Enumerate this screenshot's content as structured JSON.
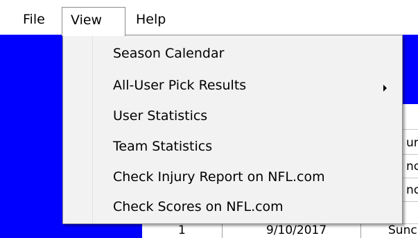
{
  "menubar": {
    "items": [
      {
        "label": "File"
      },
      {
        "label": "View"
      },
      {
        "label": "Help"
      }
    ]
  },
  "view_menu": {
    "items": [
      {
        "label": "Season Calendar",
        "has_submenu": false
      },
      {
        "label": "All-User Pick Results",
        "has_submenu": true
      },
      {
        "label": "User Statistics",
        "has_submenu": false
      },
      {
        "label": "Team Statistics",
        "has_submenu": false
      },
      {
        "label": "Check Injury Report on NFL.com",
        "has_submenu": false
      },
      {
        "label": "Check Scores on NFL.com",
        "has_submenu": false
      }
    ]
  },
  "grid": {
    "partial_cells": [
      "urs",
      "nc",
      "nc"
    ],
    "last_row": {
      "week": "1",
      "date": "9/10/2017",
      "day": "Sunc"
    }
  },
  "colors": {
    "background_band": "#0000ff",
    "menu_background": "#f2f2f2",
    "menu_border": "#8a8a8a"
  }
}
